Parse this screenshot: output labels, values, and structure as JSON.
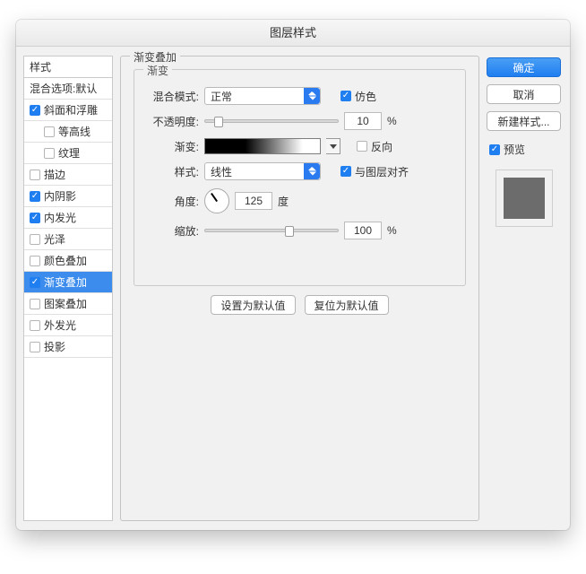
{
  "window": {
    "title": "图层样式"
  },
  "stylesCol": {
    "header": "样式",
    "items": [
      {
        "key": "blendopts",
        "label": "混合选项:默认",
        "checked": null,
        "indent": 1
      },
      {
        "key": "bevel",
        "label": "斜面和浮雕",
        "checked": true,
        "indent": 1
      },
      {
        "key": "contour",
        "label": "等高线",
        "checked": false,
        "indent": 2
      },
      {
        "key": "texture",
        "label": "纹理",
        "checked": false,
        "indent": 2
      },
      {
        "key": "stroke",
        "label": "描边",
        "checked": false,
        "indent": 1
      },
      {
        "key": "innershadow",
        "label": "内阴影",
        "checked": true,
        "indent": 1
      },
      {
        "key": "innerglow",
        "label": "内发光",
        "checked": true,
        "indent": 1
      },
      {
        "key": "satin",
        "label": "光泽",
        "checked": false,
        "indent": 1
      },
      {
        "key": "coloroverlay",
        "label": "颜色叠加",
        "checked": false,
        "indent": 1
      },
      {
        "key": "gradientoverlay",
        "label": "渐变叠加",
        "checked": true,
        "indent": 1,
        "selected": true
      },
      {
        "key": "patternoverlay",
        "label": "图案叠加",
        "checked": false,
        "indent": 1
      },
      {
        "key": "outerglow",
        "label": "外发光",
        "checked": false,
        "indent": 1
      },
      {
        "key": "dropshadow",
        "label": "投影",
        "checked": false,
        "indent": 1
      }
    ]
  },
  "panel": {
    "legend": "渐变叠加",
    "sublegend": "渐变",
    "labels": {
      "blendMode": "混合模式:",
      "opacity": "不透明度:",
      "gradient": "渐变:",
      "style": "样式:",
      "angle": "角度:",
      "scale": "缩放:",
      "degree": "度",
      "percent": "%"
    },
    "blendMode": {
      "value": "正常"
    },
    "dither": {
      "label": "仿色",
      "checked": true
    },
    "opacity": {
      "value": "10",
      "sliderPct": 7
    },
    "reverse": {
      "label": "反向",
      "checked": false
    },
    "style": {
      "value": "线性"
    },
    "alignWithLayer": {
      "label": "与图层对齐",
      "checked": true
    },
    "angle": {
      "value": "125"
    },
    "scale": {
      "value": "100",
      "sliderPct": 60
    },
    "buttons": {
      "default": "设置为默认值",
      "reset": "复位为默认值"
    }
  },
  "right": {
    "ok": "确定",
    "cancel": "取消",
    "newStyle": "新建样式...",
    "preview": {
      "label": "预览",
      "checked": true
    }
  }
}
